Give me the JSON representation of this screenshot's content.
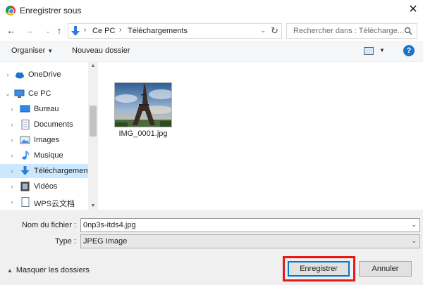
{
  "window": {
    "title": "Enregistrer sous",
    "close_icon": "close-icon",
    "app_icon": "chrome-icon"
  },
  "address_bar": {
    "crumbs": [
      "Ce PC",
      "Téléchargements"
    ],
    "icons": [
      "back-arrow-icon",
      "forward-arrow-icon",
      "up-arrow-icon",
      "download-folder-icon",
      "refresh-icon"
    ]
  },
  "search": {
    "placeholder": "Rechercher dans : Télécharge..."
  },
  "toolbar": {
    "organiser_label": "Organiser",
    "new_folder_label": "Nouveau dossier",
    "view_icon": "view-options-icon",
    "help_label": "?"
  },
  "nav_tree": {
    "items": [
      {
        "label": "OneDrive",
        "icon": "onedrive-cloud-icon",
        "level": 0,
        "selected": false
      },
      {
        "label": "Ce PC",
        "icon": "computer-icon",
        "level": 0,
        "expanded": true,
        "selected": false
      },
      {
        "label": "Bureau",
        "icon": "desktop-icon",
        "level": 1,
        "selected": false
      },
      {
        "label": "Documents",
        "icon": "documents-icon",
        "level": 1,
        "selected": false
      },
      {
        "label": "Images",
        "icon": "pictures-icon",
        "level": 1,
        "selected": false
      },
      {
        "label": "Musique",
        "icon": "music-icon",
        "level": 1,
        "selected": false
      },
      {
        "label": "Téléchargement",
        "icon": "downloads-icon",
        "level": 1,
        "selected": true
      },
      {
        "label": "Vidéos",
        "icon": "videos-icon",
        "level": 1,
        "selected": false
      },
      {
        "label": "WPS云文档",
        "icon": "wps-cloud-icon",
        "level": 1,
        "selected": false
      }
    ]
  },
  "files": [
    {
      "name": "IMG_0001.jpg",
      "icon": "eiffel-tower-thumbnail"
    }
  ],
  "form": {
    "filename_label": "Nom du fichier :",
    "filename_value": "0np3s-itds4.jpg",
    "filetype_label": "Type :",
    "filetype_value": "JPEG Image"
  },
  "footer": {
    "hide_folders_label": "Masquer les dossiers",
    "save_label": "Enregistrer",
    "cancel_label": "Annuler",
    "highlight_color": "#e21b17"
  }
}
